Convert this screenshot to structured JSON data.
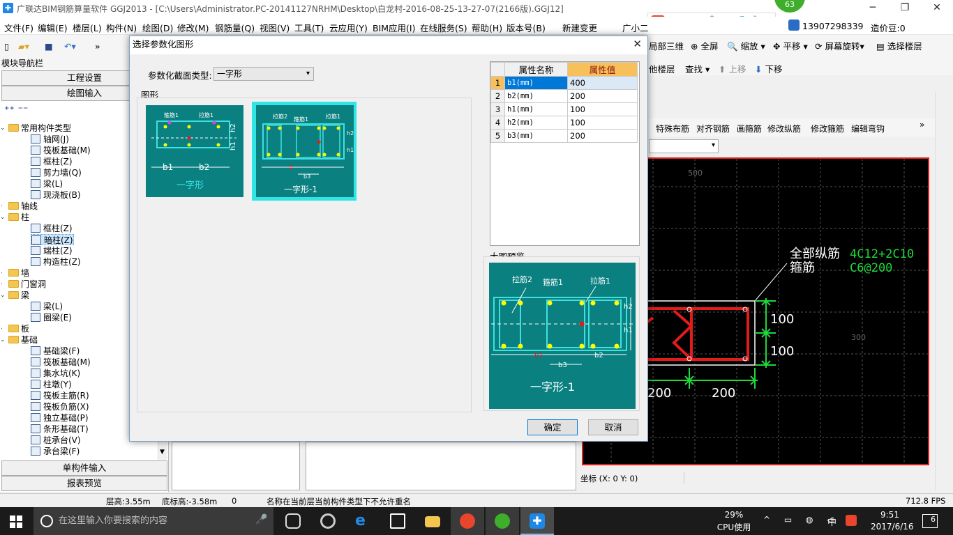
{
  "window": {
    "title": "广联达BIM钢筋算量软件 GGJ2013 - [C:\\Users\\Administrator.PC-20141127NRHM\\Desktop\\白龙村-2016-08-25-13-27-07(2166版).GGJ12]",
    "minimize": "─",
    "maximize": "❐",
    "close": "✕"
  },
  "menu": [
    "文件(F)",
    "编辑(E)",
    "楼层(L)",
    "构件(N)",
    "绘图(D)",
    "修改(M)",
    "钢筋量(Q)",
    "视图(V)",
    "工具(T)",
    "云应用(Y)",
    "BIM应用(I)",
    "在线服务(S)",
    "帮助(H)",
    "版本号(B)",
    "新建变更",
    "广小二"
  ],
  "menu_right": {
    "phone": "13907298339",
    "cost_beans": "造价豆:0"
  },
  "toolbar": {
    "items": [
      "局部三维",
      "全屏",
      "缩放",
      "平移",
      "屏幕旋转",
      "选择楼层"
    ],
    "row2": [
      "他楼层",
      "查找",
      "上移",
      "下移"
    ]
  },
  "left_panel": {
    "header": "模块导航栏",
    "project_settings": "工程设置",
    "drawing_input": "绘图输入",
    "single_input": "单构件输入",
    "report_preview": "报表预览",
    "tree": [
      {
        "label": "常用构件类型",
        "level": 0,
        "expanded": true,
        "folder": true
      },
      {
        "label": "轴网(J)",
        "level": 1
      },
      {
        "label": "筏板基础(M)",
        "level": 1
      },
      {
        "label": "框柱(Z)",
        "level": 1
      },
      {
        "label": "剪力墙(Q)",
        "level": 1
      },
      {
        "label": "梁(L)",
        "level": 1
      },
      {
        "label": "现浇板(B)",
        "level": 1
      },
      {
        "label": "轴线",
        "level": 0,
        "expanded": false,
        "folder": true
      },
      {
        "label": "柱",
        "level": 0,
        "expanded": true,
        "folder": true
      },
      {
        "label": "框柱(Z)",
        "level": 1
      },
      {
        "label": "暗柱(Z)",
        "level": 1,
        "selected": true
      },
      {
        "label": "端柱(Z)",
        "level": 1
      },
      {
        "label": "构造柱(Z)",
        "level": 1
      },
      {
        "label": "墙",
        "level": 0,
        "expanded": false,
        "folder": true
      },
      {
        "label": "门窗洞",
        "level": 0,
        "expanded": false,
        "folder": true
      },
      {
        "label": "梁",
        "level": 0,
        "expanded": true,
        "folder": true
      },
      {
        "label": "梁(L)",
        "level": 1
      },
      {
        "label": "圈梁(E)",
        "level": 1
      },
      {
        "label": "板",
        "level": 0,
        "expanded": false,
        "folder": true
      },
      {
        "label": "基础",
        "level": 0,
        "expanded": true,
        "folder": true
      },
      {
        "label": "基础梁(F)",
        "level": 1
      },
      {
        "label": "筏板基础(M)",
        "level": 1
      },
      {
        "label": "集水坑(K)",
        "level": 1
      },
      {
        "label": "柱墩(Y)",
        "level": 1
      },
      {
        "label": "筏板主筋(R)",
        "level": 1
      },
      {
        "label": "筏板负筋(X)",
        "level": 1
      },
      {
        "label": "独立基础(P)",
        "level": 1
      },
      {
        "label": "条形基础(T)",
        "level": 1
      },
      {
        "label": "桩承台(V)",
        "level": 1
      },
      {
        "label": "承台梁(F)",
        "level": 1
      }
    ]
  },
  "right_toolbar": [
    "特殊布筋",
    "对齐钢筋",
    "画箍筋",
    "修改纵筋",
    "修改箍筋",
    "编辑弯钩"
  ],
  "canvas": {
    "label_all_rebar": "全部纵筋",
    "label_stirrup": "箍筋",
    "value_all_rebar": "4C12+2C10",
    "value_stirrup": "C6@200",
    "dim_100a": "100",
    "dim_100b": "100",
    "dim_200a": "200",
    "dim_200b": "200",
    "grid_500": "500",
    "grid_300": "300",
    "coord": "坐标 (X: 0 Y: 0)"
  },
  "status_bar": {
    "floor_height": "层高:3.55m",
    "bottom_height": "底标高:-3.58m",
    "zero": "0",
    "message": "名称在当前层当前构件类型下不允许重名",
    "fps": "712.8 FPS"
  },
  "taskbar": {
    "search_placeholder": "在这里输入你要搜索的内容",
    "cpu_percent": "29%",
    "cpu_label": "CPU使用",
    "ime": "中",
    "time": "9:51",
    "date": "2017/6/16",
    "notif_count": "6"
  },
  "badge": "63",
  "dialog": {
    "title": "选择参数化图形",
    "close": "✕",
    "type_label": "参数化截面类型:",
    "type_value": "一字形",
    "shapes_label": "图形",
    "shapes": [
      {
        "name": "一字形",
        "selected": false,
        "labels": {
          "stirrup": "箍筋1",
          "tie": "拉筋1",
          "b1": "b1",
          "b2": "b2",
          "h1": "h1",
          "h2": "h2"
        }
      },
      {
        "name": "一字形-1",
        "selected": true,
        "labels": {
          "tie2": "拉筋2",
          "stirrup": "箍筋1",
          "tie": "拉筋1",
          "b3": "b3",
          "h1": "h1",
          "h2": "h2"
        }
      }
    ],
    "table_headers": [
      "属性名称",
      "属性值"
    ],
    "table_rows": [
      {
        "idx": "1",
        "name": "b1(mm)",
        "value": "400"
      },
      {
        "idx": "2",
        "name": "b2(mm)",
        "value": "200"
      },
      {
        "idx": "3",
        "name": "h1(mm)",
        "value": "100"
      },
      {
        "idx": "4",
        "name": "h2(mm)",
        "value": "100"
      },
      {
        "idx": "5",
        "name": "b3(mm)",
        "value": "200"
      }
    ],
    "preview_label": "大图预览",
    "preview": {
      "tie2": "拉筋2",
      "stirrup": "箍筋1",
      "tie1": "拉筋1",
      "h2": "h2",
      "h1": "h1",
      "b3": "b3",
      "b1": "b1",
      "b2": "b2",
      "caption": "一字形-1"
    },
    "ok": "确定",
    "cancel": "取消"
  }
}
